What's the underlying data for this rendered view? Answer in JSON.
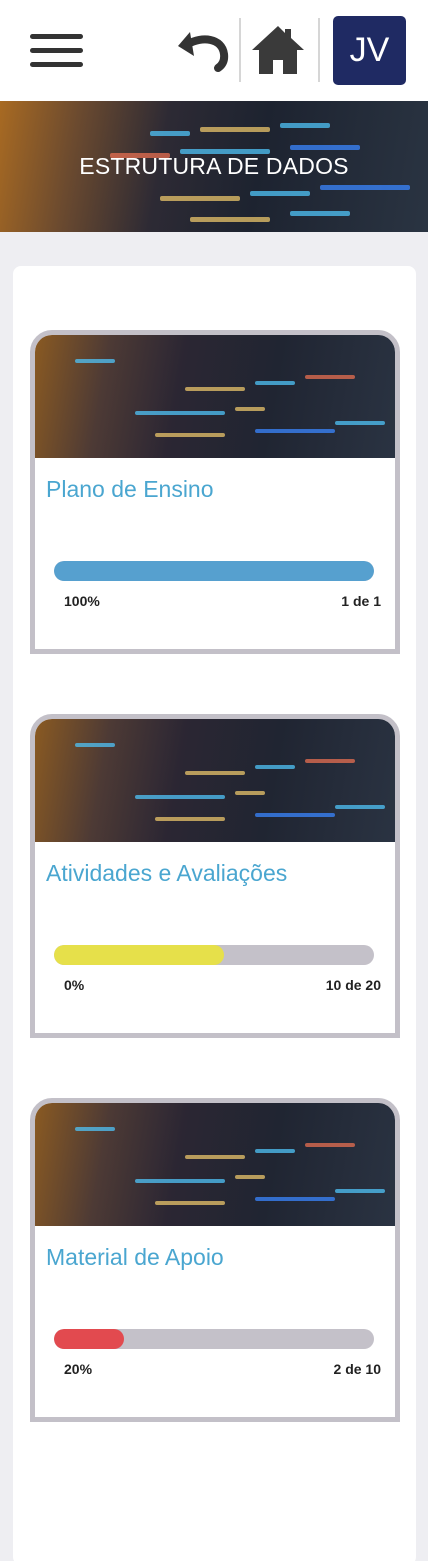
{
  "header": {
    "menu_icon": "hamburger-menu-icon",
    "undo_icon": "undo-arrow-icon",
    "home_icon": "home-icon",
    "avatar_initials": "JV",
    "avatar_color": "#1f2a63"
  },
  "hero": {
    "title": "ESTRUTURA DE DADOS"
  },
  "cards": [
    {
      "title": "Plano de Ensino",
      "percent_label": "100%",
      "count_label": "1 de 1",
      "progress": 1.0,
      "bar_color": "#56a0cf"
    },
    {
      "title": "Atividades e Avaliações",
      "percent_label": "0%",
      "count_label": "10 de 20",
      "progress": 0.53,
      "bar_color": "#e6e04a"
    },
    {
      "title": "Material de Apoio",
      "percent_label": "20%",
      "count_label": "2 de 10",
      "progress": 0.22,
      "bar_color": "#e24a4f"
    }
  ]
}
